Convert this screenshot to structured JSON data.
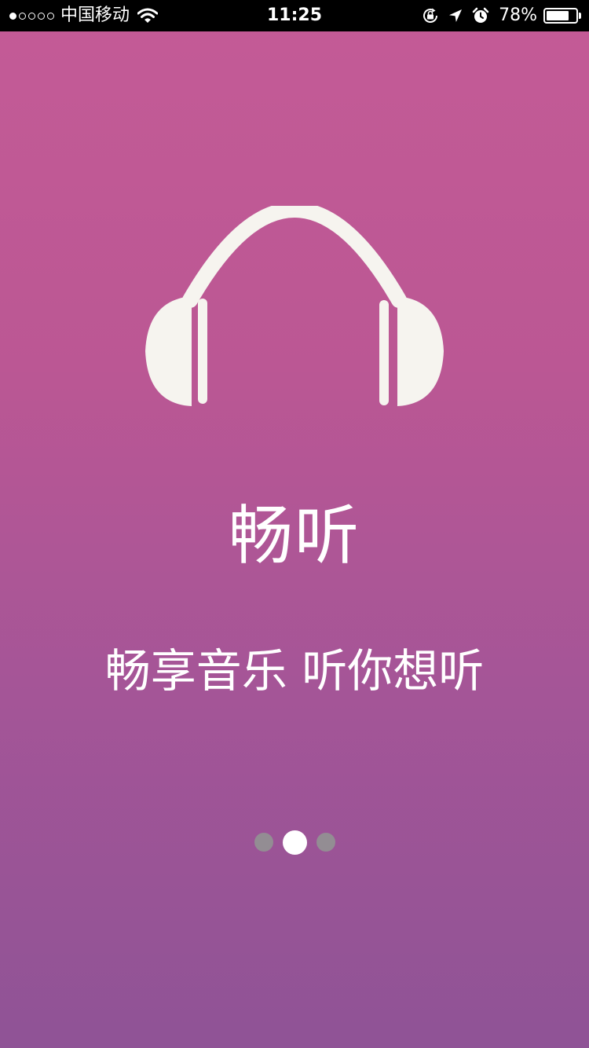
{
  "status_bar": {
    "signal_dots_filled": 1,
    "signal_dots_total": 5,
    "carrier": "中国移动",
    "time": "11:25",
    "battery_percent": "78%",
    "battery_level": 0.78,
    "icons": [
      "wifi-icon",
      "orientation-lock-icon",
      "location-arrow-icon",
      "alarm-icon",
      "battery-icon"
    ]
  },
  "splash": {
    "icon": "headphones-icon",
    "title": "畅听",
    "slogan": "畅享音乐 听你想听"
  },
  "pager": {
    "total_pages": 3,
    "current_page": 2
  },
  "colors": {
    "background_top": "#c45b96",
    "background_bottom": "#8f5396",
    "icon_fill": "#f6f4ef",
    "dot_inactive": "#938d93",
    "dot_active": "#ffffff"
  }
}
